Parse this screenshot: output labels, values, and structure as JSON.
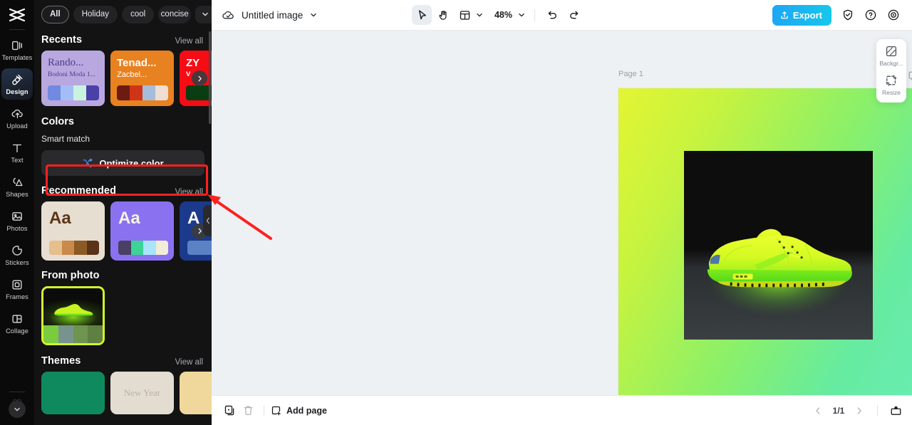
{
  "rail": {
    "logo_icon": "capcut-logo-icon",
    "items": [
      {
        "label": "Templates",
        "icon": "templates-icon",
        "active": false
      },
      {
        "label": "Design",
        "icon": "design-icon",
        "active": true
      },
      {
        "label": "Upload",
        "icon": "upload-icon",
        "active": false
      },
      {
        "label": "Text",
        "icon": "text-icon",
        "active": false
      },
      {
        "label": "Shapes",
        "icon": "shapes-icon",
        "active": false
      },
      {
        "label": "Photos",
        "icon": "photos-icon",
        "active": false
      },
      {
        "label": "Stickers",
        "icon": "stickers-icon",
        "active": false
      },
      {
        "label": "Frames",
        "icon": "frames-icon",
        "active": false
      },
      {
        "label": "Collage",
        "icon": "collage-icon",
        "active": false
      }
    ],
    "expand_icon": "chevron-down-icon"
  },
  "panel": {
    "chips": [
      {
        "label": "All",
        "active": true
      },
      {
        "label": "Holiday",
        "active": false
      },
      {
        "label": "cool",
        "active": false
      },
      {
        "label": "concise",
        "active": false
      }
    ],
    "chips_more_icon": "chevron-down-icon",
    "recents": {
      "title": "Recents",
      "view_all": "View all",
      "cards": [
        {
          "title": "Rando...",
          "subtitle": "Bodoni Moda 1...",
          "bg": "#b9a8e0",
          "title_color": "#4a3b8c",
          "subtitle_color": "#4a3b8c",
          "swatches": [
            "#6f8ae0",
            "#a5bdf7",
            "#c9f3de",
            "#4b3fa8"
          ]
        },
        {
          "title": "Tenad...",
          "subtitle": "Zacbel...",
          "bg": "#e8811f",
          "title_color": "#ffffff",
          "subtitle_color": "#ffffff",
          "swatches": [
            "#6d1a12",
            "#cf3418",
            "#a6bcdb",
            "#efdcd2"
          ]
        },
        {
          "title": "ZY",
          "subtitle": "V",
          "bg": "#f50c15",
          "title_color": "#ffffff",
          "subtitle_color": "#ffffff",
          "swatches": [
            "#0b3d12",
            "#0b3d12",
            "#0b3d12",
            "#0b3d12"
          ]
        }
      ],
      "next_icon": "chevron-right-icon"
    },
    "colors": {
      "title": "Colors",
      "smart_match": "Smart match",
      "optimize_label": "Optimize color",
      "optimize_icon": "shuffle-icon"
    },
    "recommended": {
      "title": "Recommended",
      "view_all": "View all",
      "cards": [
        {
          "sample": "Aa",
          "bg": "#e7ded2",
          "text_color": "#5a3418",
          "swatches": [
            "#e5bf8c",
            "#c98a4b",
            "#8c5a24",
            "#5a3418"
          ]
        },
        {
          "sample": "Aa",
          "bg": "#8a71f0",
          "text_color": "#f5f2e6",
          "swatches": [
            "#494063",
            "#3cd396",
            "#a9e4fb",
            "#f2edd7"
          ]
        },
        {
          "sample": "A",
          "bg": "#1c3a8c",
          "text_color": "#ffffff",
          "swatches": [
            "#5a82c4",
            "#5a82c4",
            "#5a82c4",
            "#5a82c4"
          ]
        }
      ],
      "next_icon": "chevron-right-icon"
    },
    "from_photo": {
      "title": "From photo",
      "swatches": [
        "#7bcb3f",
        "#78938d",
        "#6f9451",
        "#5e8042"
      ]
    },
    "themes": {
      "title": "Themes",
      "view_all": "View all",
      "cards": [
        {
          "bg": "#0f8a5f",
          "label": ""
        },
        {
          "bg": "#e3ddd1",
          "label": "New Year"
        },
        {
          "bg": "#f0d79b",
          "label": ""
        }
      ]
    },
    "collapse_icon": "chevron-left-icon"
  },
  "annotation": {
    "box_color": "#ff2020",
    "arrow_color": "#ff2020"
  },
  "topbar": {
    "cloud_icon": "cloud-save-icon",
    "doc_title": "Untitled image",
    "title_chevron_icon": "chevron-down-icon",
    "select_tool_icon": "cursor-arrow-icon",
    "hand_tool_icon": "hand-icon",
    "layout_icon": "layout-icon",
    "layout_chevron_icon": "chevron-down-icon",
    "zoom_value": "48%",
    "zoom_chevron_icon": "chevron-down-icon",
    "undo_icon": "undo-icon",
    "redo_icon": "redo-icon",
    "export_label": "Export",
    "export_icon": "export-upload-icon",
    "export_color": "#17bce6",
    "shield_icon": "shield-check-icon",
    "help_icon": "help-circle-icon",
    "settings_icon": "settings-gear-icon"
  },
  "canvas": {
    "page_label": "Page 1",
    "duplicate_icon": "duplicate-page-icon",
    "more_icon": "more-dots-icon",
    "gradient_from": "#e3f533",
    "gradient_to": "#6aecb6",
    "photo_alt": "neon green sneaker on dark background"
  },
  "rightdock": {
    "items": [
      {
        "label": "Backgr...",
        "icon": "background-icon"
      },
      {
        "label": "Resize",
        "icon": "resize-icon"
      }
    ]
  },
  "bottombar": {
    "duplicate_icon": "duplicate-icon",
    "delete_icon": "trash-icon",
    "add_page_label": "Add page",
    "add_page_icon": "add-page-icon",
    "prev_icon": "chevron-left-icon",
    "page_indicator": "1/1",
    "next_icon": "chevron-right-icon",
    "present_icon": "present-icon"
  }
}
